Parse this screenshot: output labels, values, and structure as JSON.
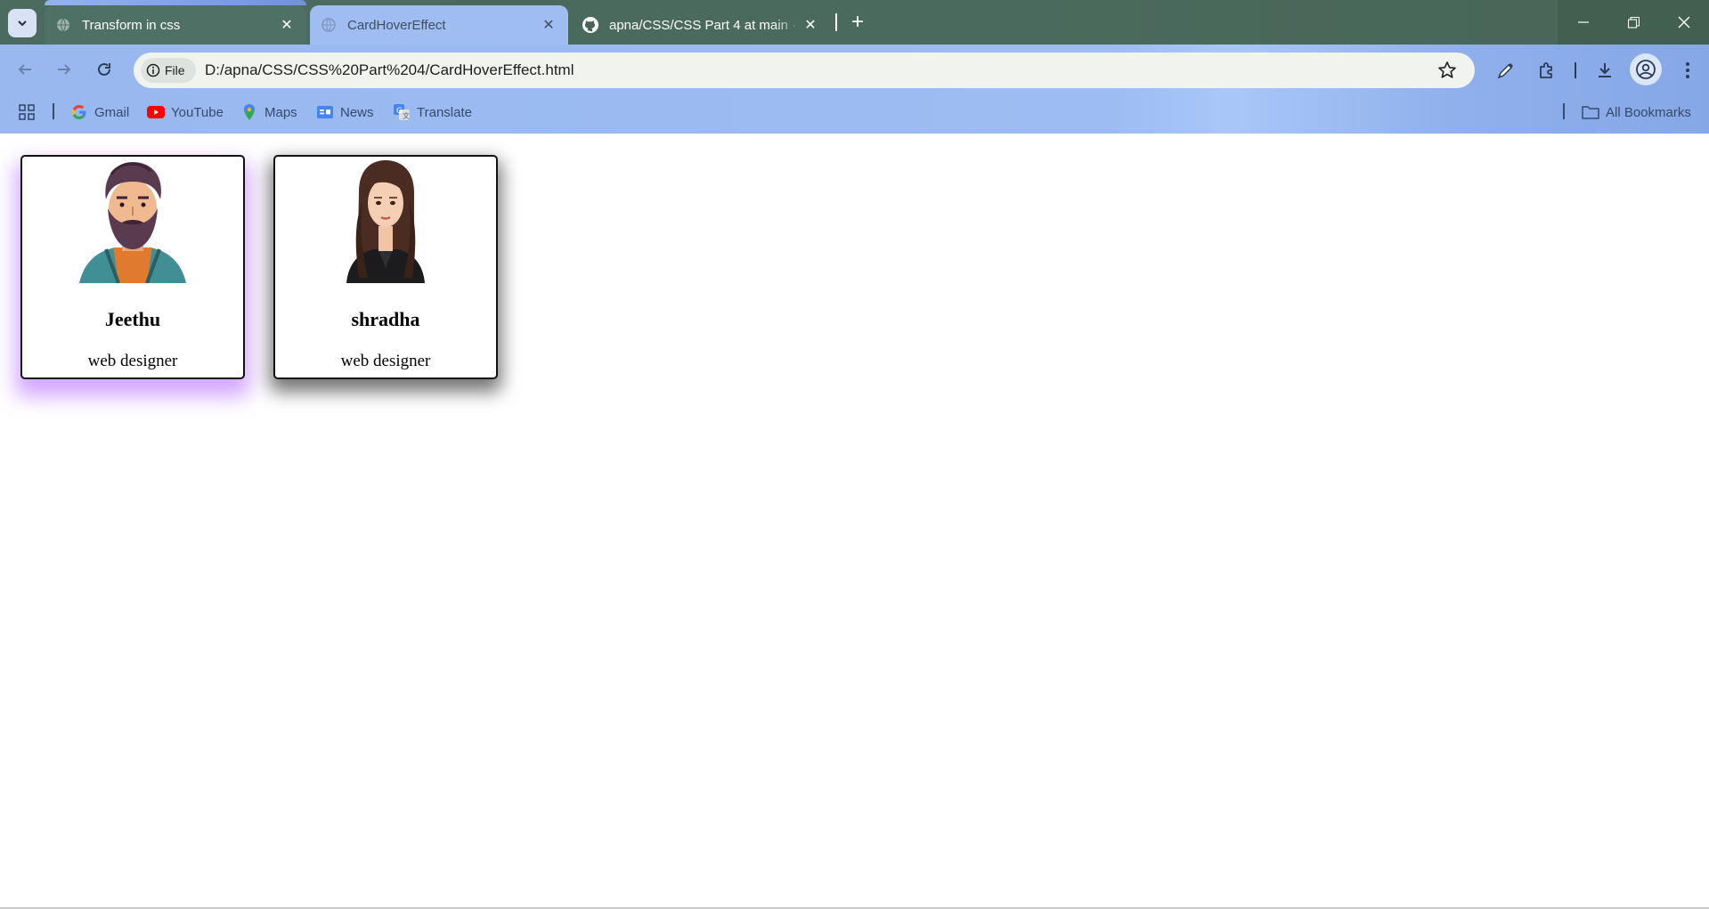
{
  "browser": {
    "tabs": [
      {
        "title": "Transform in css",
        "icon": "globe-icon"
      },
      {
        "title": "CardHoverEffect",
        "icon": "globe-icon"
      },
      {
        "title": "apna/CSS/CSS Part 4 at main · J",
        "icon": "github-icon"
      }
    ],
    "address": {
      "chip_label": "File",
      "url": "D:/apna/CSS/CSS%20Part%204/CardHoverEffect.html"
    },
    "bookmarks": [
      {
        "label": "Gmail",
        "icon": "google-icon"
      },
      {
        "label": "YouTube",
        "icon": "youtube-icon"
      },
      {
        "label": "Maps",
        "icon": "maps-icon"
      },
      {
        "label": "News",
        "icon": "news-icon"
      },
      {
        "label": "Translate",
        "icon": "translate-icon"
      }
    ],
    "all_bookmarks_label": "All Bookmarks"
  },
  "cards": [
    {
      "name": "Jeethu",
      "role": "web designer",
      "avatar": "bearded-man-illustration",
      "glow_color": "#b266ff"
    },
    {
      "name": "shradha",
      "role": "web designer",
      "avatar": "woman-illustration",
      "glow_color": "#000000"
    }
  ]
}
